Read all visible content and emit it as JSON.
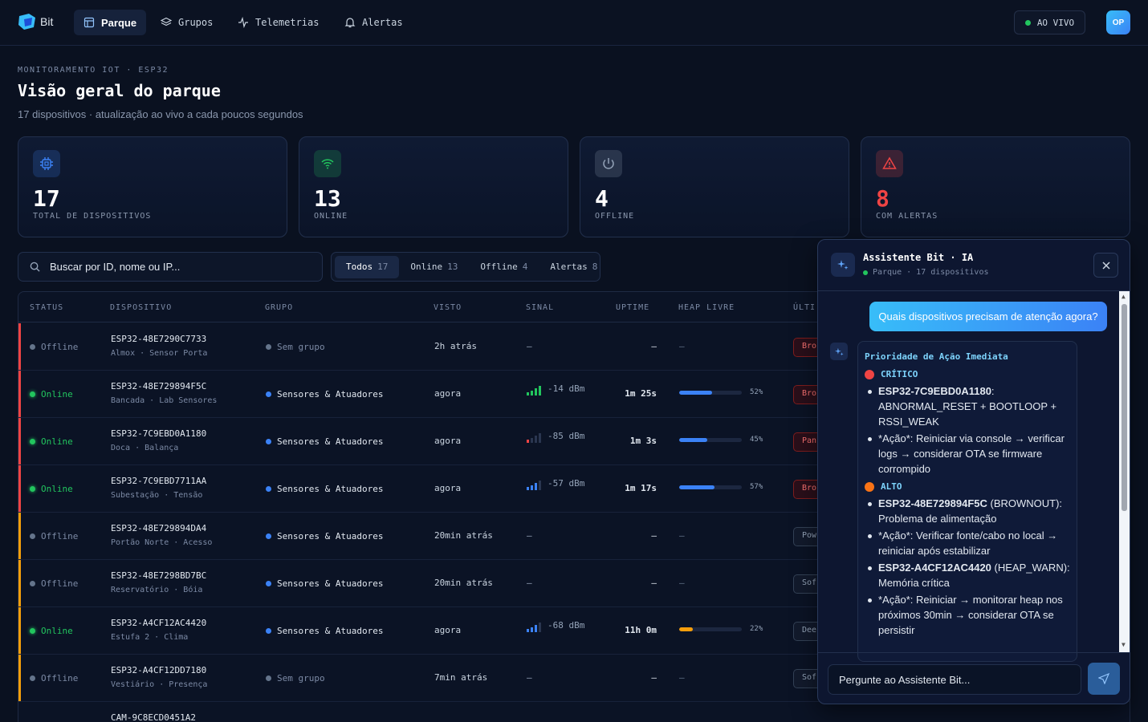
{
  "brand": {
    "name": "Bit"
  },
  "nav": [
    {
      "label": "Parque",
      "icon": "layout-icon",
      "active": true
    },
    {
      "label": "Grupos",
      "icon": "layers-icon",
      "active": false
    },
    {
      "label": "Telemetrias",
      "icon": "activity-icon",
      "active": false
    },
    {
      "label": "Alertas",
      "icon": "bell-icon",
      "active": false
    }
  ],
  "live_label": "AO VIVO",
  "user_initials": "OP",
  "header": {
    "eyebrow": "MONITORAMENTO IOT · ESP32",
    "title": "Visão geral do parque",
    "subtitle": "17 dispositivos · atualização ao vivo a cada poucos segundos"
  },
  "stats": [
    {
      "value": "17",
      "label": "TOTAL DE DISPOSITIVOS",
      "icon": "chip-icon",
      "color": "#3b82f6"
    },
    {
      "value": "13",
      "label": "ONLINE",
      "icon": "wifi-icon",
      "color": "#22c55e"
    },
    {
      "value": "4",
      "label": "OFFLINE",
      "icon": "power-icon",
      "color": "#94a3b8"
    },
    {
      "value": "8",
      "label": "COM ALERTAS",
      "icon": "warning-icon",
      "color": "#ef4444"
    }
  ],
  "search": {
    "placeholder": "Buscar por ID, nome ou IP..."
  },
  "filters": [
    {
      "label": "Todos",
      "count": "17",
      "active": true
    },
    {
      "label": "Online",
      "count": "13",
      "active": false
    },
    {
      "label": "Offline",
      "count": "4",
      "active": false
    },
    {
      "label": "Alertas",
      "count": "8",
      "active": false
    }
  ],
  "table": {
    "columns": [
      "STATUS",
      "DISPOSITIVO",
      "GRUPO",
      "VISTO",
      "SINAL",
      "UPTIME",
      "HEAP LIVRE",
      "ÚLTI"
    ],
    "rows": [
      {
        "status": "Offline",
        "online": false,
        "name": "ESP32-48E7290C7733",
        "location": "Almox · Sensor Porta",
        "group": "Sem grupo",
        "grouped": false,
        "seen": "2h atrás",
        "signal": "—",
        "bars": 0,
        "uptime": "—",
        "heap": "—",
        "heap_pct": null,
        "tag": "Bro",
        "accent": "#ef4444"
      },
      {
        "status": "Online",
        "online": true,
        "name": "ESP32-48E729894F5C",
        "location": "Bancada · Lab Sensores",
        "group": "Sensores & Atuadores",
        "grouped": true,
        "seen": "agora",
        "signal": "-14 dBm",
        "bars": 4,
        "bar_color": "#22c55e",
        "uptime": "1m 25s",
        "heap": "52%",
        "heap_pct": 52,
        "tag": "Bro",
        "accent": "#ef4444"
      },
      {
        "status": "Online",
        "online": true,
        "name": "ESP32-7C9EBD0A1180",
        "location": "Doca · Balança",
        "group": "Sensores & Atuadores",
        "grouped": true,
        "seen": "agora",
        "signal": "-85 dBm",
        "bars": 1,
        "bar_color": "#ef4444",
        "uptime": "1m 3s",
        "heap": "45%",
        "heap_pct": 45,
        "tag": "Pan",
        "accent": "#ef4444"
      },
      {
        "status": "Online",
        "online": true,
        "name": "ESP32-7C9EBD7711AA",
        "location": "Subestação · Tensão",
        "group": "Sensores & Atuadores",
        "grouped": true,
        "seen": "agora",
        "signal": "-57 dBm",
        "bars": 3,
        "bar_color": "#3b82f6",
        "uptime": "1m 17s",
        "heap": "57%",
        "heap_pct": 57,
        "tag": "Bro",
        "accent": "#ef4444"
      },
      {
        "status": "Offline",
        "online": false,
        "name": "ESP32-48E729894DA4",
        "location": "Portão Norte · Acesso",
        "group": "Sensores & Atuadores",
        "grouped": true,
        "seen": "20min atrás",
        "signal": "—",
        "bars": 0,
        "uptime": "—",
        "heap": "—",
        "heap_pct": null,
        "tag": "Pow",
        "accent": "#f59e0b"
      },
      {
        "status": "Offline",
        "online": false,
        "name": "ESP32-48E7298BD7BC",
        "location": "Reservatório · Bóia",
        "group": "Sensores & Atuadores",
        "grouped": true,
        "seen": "20min atrás",
        "signal": "—",
        "bars": 0,
        "uptime": "—",
        "heap": "—",
        "heap_pct": null,
        "tag": "Sof",
        "accent": "#f59e0b"
      },
      {
        "status": "Online",
        "online": true,
        "name": "ESP32-A4CF12AC4420",
        "location": "Estufa 2 · Clima",
        "group": "Sensores & Atuadores",
        "grouped": true,
        "seen": "agora",
        "signal": "-68 dBm",
        "bars": 3,
        "bar_color": "#3b82f6",
        "uptime": "11h 0m",
        "heap": "22%",
        "heap_pct": 22,
        "tag": "Dee",
        "accent": "#f59e0b"
      },
      {
        "status": "Offline",
        "online": false,
        "name": "ESP32-A4CF12DD7180",
        "location": "Vestiário · Presença",
        "group": "Sem grupo",
        "grouped": false,
        "seen": "7min atrás",
        "signal": "—",
        "bars": 0,
        "uptime": "—",
        "heap": "—",
        "heap_pct": null,
        "tag": "Sof",
        "accent": "#f59e0b"
      },
      {
        "status": "",
        "online": true,
        "name": "CAM-9C8ECD0451A2",
        "location": "",
        "group": "",
        "grouped": true,
        "seen": "",
        "signal": "",
        "bars": 0,
        "uptime": "",
        "heap": "",
        "heap_pct": null,
        "tag": "",
        "accent": "#0b1325"
      }
    ]
  },
  "assistant": {
    "title": "Assistente Bit · IA",
    "context": "Parque · 17 dispositivos",
    "user_message": "Quais dispositivos precisam de atenção agora?",
    "reply_heading": "Prioridade de Ação Imediata",
    "priorities": [
      {
        "level": "CRÍTICO",
        "color": "#ef4444",
        "items": [
          {
            "bold": "ESP32-7C9EBD0A1180",
            "text": ": ABNORMAL_RESET + BOOTLOOP + RSSI_WEAK"
          },
          {
            "bold": "",
            "text": "*Ação*: Reiniciar via console → verificar logs → considerar OTA se firmware corrompido"
          }
        ]
      },
      {
        "level": "ALTO",
        "color": "#f97316",
        "items": [
          {
            "bold": "ESP32-48E729894F5C",
            "text": " (BROWNOUT): Problema de alimentação"
          },
          {
            "bold": "",
            "text": "*Ação*: Verificar fonte/cabo no local → reiniciar após estabilizar"
          },
          {
            "bold": "ESP32-A4CF12AC4420",
            "text": " (HEAP_WARN): Memória crítica"
          },
          {
            "bold": "",
            "text": "*Ação*: Reiniciar → monitorar heap nos próximos 30min → considerar OTA se persistir"
          }
        ]
      }
    ],
    "input_placeholder": "Pergunte ao Assistente Bit..."
  }
}
